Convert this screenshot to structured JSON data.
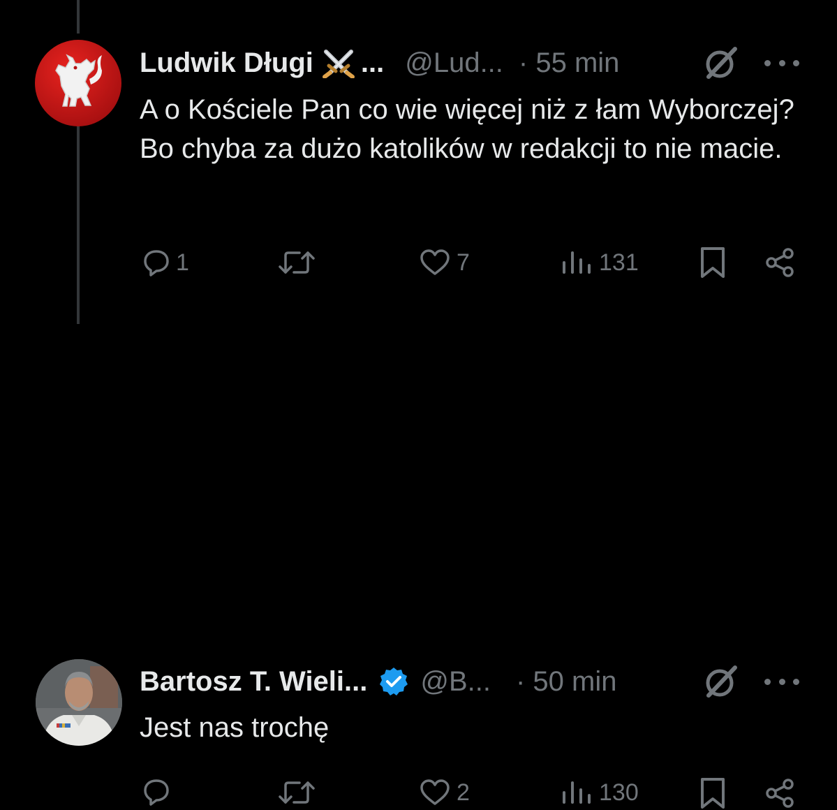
{
  "tweets": [
    {
      "author_name": "Ludwik Długi",
      "name_truncation": "...",
      "handle": "@Lud...",
      "time": "· 55 min",
      "text": "A o Kościele Pan co wie więcej niż z łam Wyborczej? Bo chyba za dużo katolików w redakcji to nie macie.",
      "badge": "crossed-swords-emoji",
      "stats": {
        "replies": "1",
        "retweets": "",
        "likes": "7",
        "views": "131"
      }
    },
    {
      "author_name": "Bartosz T. Wieli...",
      "handle": "@B...",
      "time": "· 50 min",
      "text": "Jest nas trochę",
      "badge": "verified-badge",
      "stats": {
        "replies": "",
        "retweets": "",
        "likes": "2",
        "views": "130"
      }
    }
  ],
  "colors": {
    "background": "#000000",
    "text": "#e7e9ea",
    "muted": "#71767b",
    "verified": "#1d9bf0",
    "thread_line": "#333639"
  },
  "icons": [
    "reply-icon",
    "retweet-icon",
    "like-icon",
    "views-icon",
    "bookmark-icon",
    "share-icon",
    "grok-icon",
    "more-icon"
  ]
}
